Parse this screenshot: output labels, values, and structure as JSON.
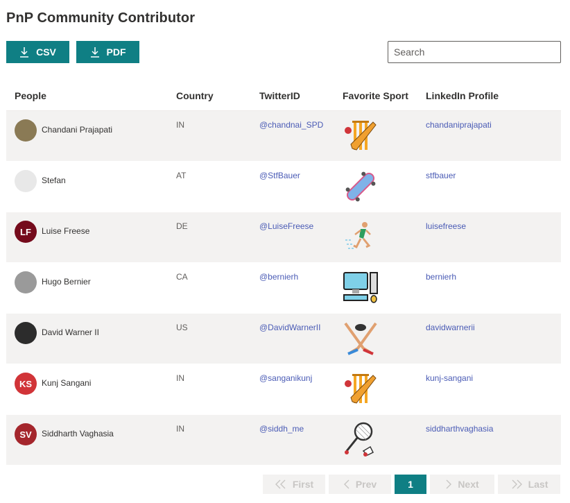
{
  "page": {
    "title": "PnP Community Contributor"
  },
  "toolbar": {
    "csv_label": "CSV",
    "pdf_label": "PDF"
  },
  "search": {
    "placeholder": "Search",
    "value": ""
  },
  "table": {
    "headers": {
      "people": "People",
      "country": "Country",
      "twitter": "TwitterID",
      "sport": "Favorite Sport",
      "linkedin": "LinkedIn Profile"
    },
    "rows": [
      {
        "name": "Chandani Prajapati",
        "initials": "",
        "avatar_color": "#8a7a55",
        "country": "IN",
        "twitter": "@chandnai_SPD",
        "sport_icon": "cricket-icon",
        "linkedin": "chandaniprajapati"
      },
      {
        "name": "Stefan",
        "initials": "",
        "avatar_color": "#e8e8e8",
        "country": "AT",
        "twitter": "@StfBauer",
        "sport_icon": "skateboard-icon",
        "linkedin": "stfbauer"
      },
      {
        "name": "Luise Freese",
        "initials": "LF",
        "avatar_color": "#750b1c",
        "country": "DE",
        "twitter": "@LuiseFreese",
        "sport_icon": "running-icon",
        "linkedin": "luisefreese"
      },
      {
        "name": "Hugo Bernier",
        "initials": "",
        "avatar_color": "#9a9a9a",
        "country": "CA",
        "twitter": "@bernierh",
        "sport_icon": "computer-icon",
        "linkedin": "bernierh"
      },
      {
        "name": "David Warner II",
        "initials": "",
        "avatar_color": "#2c2c2c",
        "country": "US",
        "twitter": "@DavidWarnerII",
        "sport_icon": "hockey-icon",
        "linkedin": "davidwarnerii"
      },
      {
        "name": "Kunj Sangani",
        "initials": "KS",
        "avatar_color": "#d13438",
        "country": "IN",
        "twitter": "@sanganikunj",
        "sport_icon": "cricket-icon",
        "linkedin": "kunj-sangani"
      },
      {
        "name": "Siddharth Vaghasia",
        "initials": "SV",
        "avatar_color": "#a4262c",
        "country": "IN",
        "twitter": "@siddh_me",
        "sport_icon": "badminton-icon",
        "linkedin": "siddharthvaghasia"
      }
    ]
  },
  "pagination": {
    "first": "First",
    "prev": "Prev",
    "current": "1",
    "next": "Next",
    "last": "Last"
  }
}
